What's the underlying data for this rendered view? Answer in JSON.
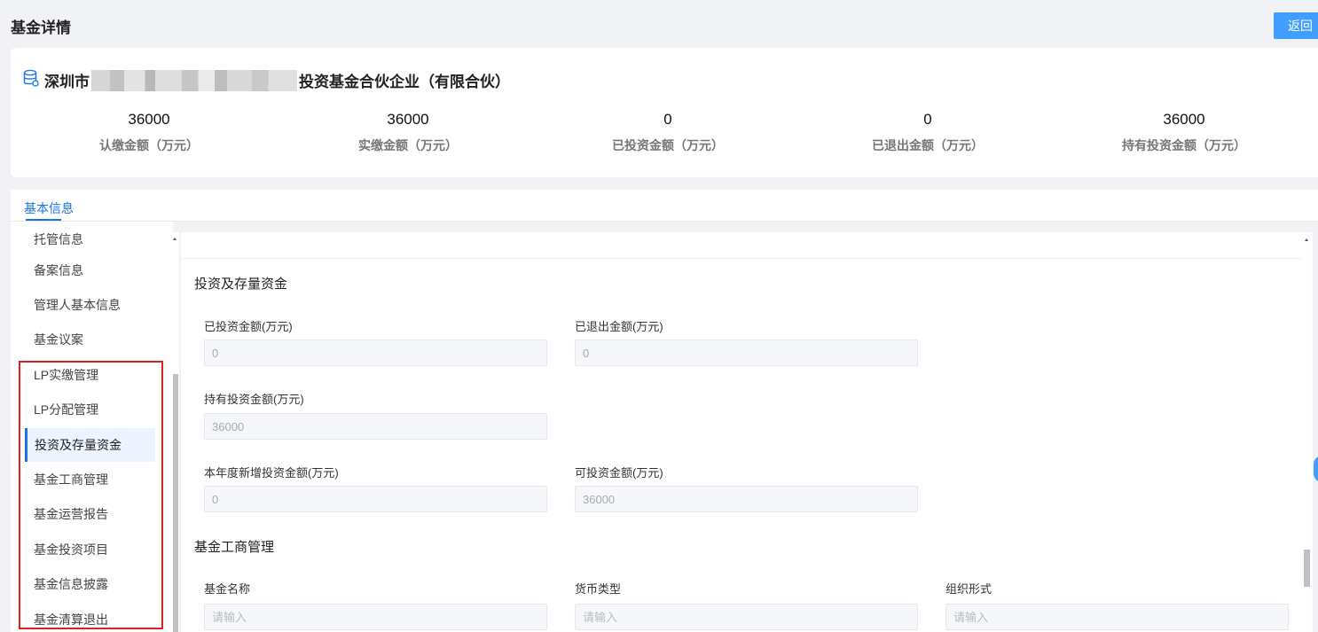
{
  "header": {
    "title": "基金详情",
    "back_label": "返回"
  },
  "summary": {
    "fund_name_prefix": "深圳市",
    "fund_name_suffix": "投资基金合伙企业（有限合伙）",
    "stats": [
      {
        "value": "36000",
        "label": "认缴金额（万元）"
      },
      {
        "value": "36000",
        "label": "实缴金额（万元）"
      },
      {
        "value": "0",
        "label": "已投资金额（万元）"
      },
      {
        "value": "0",
        "label": "已退出金额（万元）"
      },
      {
        "value": "36000",
        "label": "持有投资金额（万元）"
      }
    ]
  },
  "tabs": {
    "basic": "基本信息"
  },
  "sidebar": {
    "items": [
      {
        "label": "托管信息"
      },
      {
        "label": "备案信息"
      },
      {
        "label": "管理人基本信息"
      },
      {
        "label": "基金议案"
      },
      {
        "label": "LP实缴管理"
      },
      {
        "label": "LP分配管理"
      },
      {
        "label": "投资及存量资金"
      },
      {
        "label": "基金工商管理"
      },
      {
        "label": "基金运营报告"
      },
      {
        "label": "基金投资项目"
      },
      {
        "label": "基金信息披露"
      },
      {
        "label": "基金清算退出"
      }
    ],
    "active": "投资及存量资金"
  },
  "investment": {
    "title": "投资及存量资金",
    "invested_label": "已投资金额(万元)",
    "invested_value": "0",
    "exited_label": "已退出金额(万元)",
    "exited_value": "0",
    "holding_label": "持有投资金额(万元)",
    "holding_value": "36000",
    "new_label": "本年度新增投资金额(万元)",
    "new_value": "0",
    "available_label": "可投资金额(万元)",
    "available_value": "36000"
  },
  "business": {
    "title": "基金工商管理",
    "name_label": "基金名称",
    "currency_label": "货币类型",
    "org_label": "组织形式",
    "placeholder": "请输入"
  }
}
